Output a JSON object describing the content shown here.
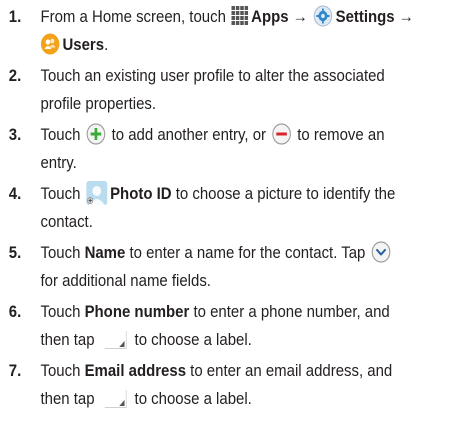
{
  "steps": [
    {
      "number": "1.",
      "line1": {
        "t1": "From a Home screen, touch ",
        "apps_label": "Apps",
        "arrow1": " → ",
        "settings_label": "Settings",
        "arrow2": " →"
      },
      "line2": {
        "users_label": "Users",
        "t2": "."
      }
    },
    {
      "number": "2.",
      "line1": "Touch an existing user profile to alter the associated",
      "line2": "profile properties."
    },
    {
      "number": "3.",
      "line1": {
        "t1": "Touch ",
        "t2": " to add another entry, or ",
        "t3": " to remove an"
      },
      "line2": "entry."
    },
    {
      "number": "4.",
      "line1": {
        "t1": "Touch ",
        "photo_label": "Photo ID",
        "t2": " to choose a picture to identify the"
      },
      "line2": "contact."
    },
    {
      "number": "5.",
      "line1": {
        "t1": "Touch ",
        "name_label": "Name",
        "t2": " to enter a name for the contact. Tap "
      },
      "line2": "for additional name fields."
    },
    {
      "number": "6.",
      "line1": {
        "t1": "Touch ",
        "phone_label": "Phone number",
        "t2": " to enter a phone number, and"
      },
      "line2": {
        "t1": "then tap ",
        "t2": " to choose a label."
      }
    },
    {
      "number": "7.",
      "line1": {
        "t1": "Touch ",
        "email_label": "Email address",
        "t2": " to enter an email address, and"
      },
      "line2": {
        "t1": "then tap ",
        "t2": " to choose a label."
      }
    }
  ],
  "icons": {
    "apps": "apps-grid-icon",
    "settings": "gear-icon",
    "users": "users-icon",
    "add": "plus-circle-icon",
    "remove": "minus-circle-icon",
    "photo": "contact-photo-icon",
    "expand": "chevron-down-circle-icon",
    "label_menu": "dropdown-triangle-icon"
  },
  "colors": {
    "text": "#231f20",
    "plus": "#3aa935",
    "minus": "#d9232d",
    "chevron": "#2b5f9e",
    "gear": "#2f87c9",
    "users_badge": "#f2a31b"
  }
}
